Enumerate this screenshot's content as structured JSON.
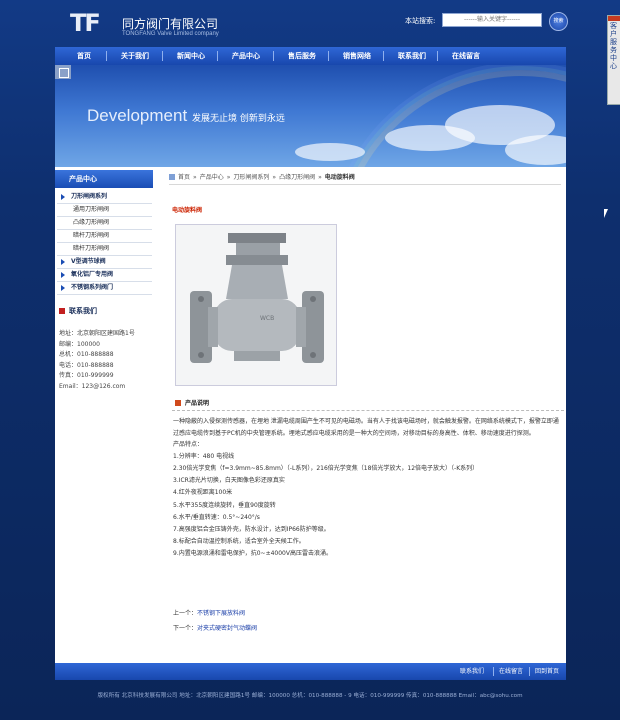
{
  "header": {
    "logo_mark": "TF",
    "company_cn": "同方阀门有限公司",
    "company_en": "TONGFANG Valve Limited company",
    "search_label": "本站搜索:",
    "search_placeholder": "------输入关键字------",
    "search_button": "搜索"
  },
  "side_tab": {
    "label": "客户服务中心"
  },
  "nav": {
    "items": [
      "首页",
      "关于我们",
      "新闻中心",
      "产品中心",
      "售后服务",
      "销售网络",
      "联系我们",
      "在线留言"
    ]
  },
  "banner": {
    "english": "Development",
    "slogan": "发展无止境 创新到永远"
  },
  "sidebar": {
    "title": "产品中心",
    "categories": [
      {
        "label": "刀形闸阀系列",
        "type": "main"
      },
      {
        "label": "通用刀形闸阀",
        "type": "sub"
      },
      {
        "label": "凸缘刀形闸阀",
        "type": "sub"
      },
      {
        "label": "暗杆刀形闸阀",
        "type": "sub"
      },
      {
        "label": "暗杆刀形闸阀",
        "type": "sub"
      },
      {
        "label": "V型调节球阀",
        "type": "main"
      },
      {
        "label": "氧化铝厂专用阀",
        "type": "main"
      },
      {
        "label": "不锈钢系列阀门",
        "type": "main"
      }
    ],
    "contact_title": "联系我们",
    "contact_lines": [
      "地址：北京朝阳区建国路1号",
      "邮编：100000",
      "总机：010-888888",
      "电话：010-888888",
      "传真：010-999999",
      "Email：123@126.com"
    ]
  },
  "breadcrumb": {
    "items": [
      "首页",
      "产品中心",
      "刀形闸阀系列",
      "凸缘刀形闸阀"
    ],
    "separator": "»",
    "current": "电动旋料阀"
  },
  "product": {
    "title": "电动旋料阀",
    "desc_title": "产品说明",
    "paragraph": "一种隐蔽的入侵探测传感器，在埋地 泄漏电缆周围产生不可见的电磁场。当有人于找该电磁场时，就会触发报警。在网络系统模式下，报警立即通过感应电缆传到基于PC机的中央管理系统。埋地式感应电缆采用的是一种大的空间场，对移动目标的身高性、体积、移动速度进行探测。",
    "features_title": "产品特点：",
    "features": [
      "1.分辨率：480 电视线",
      "2.30倍光学变焦（f=3.9mm~85.8mm）（-L系列），216倍光学变焦（18倍光学放大，12倍电子放大）（-K系列）",
      "3.ICR滤光片切换，白天图像色彩还原真实",
      "4.红外夜视距离100米",
      "5.水平355度连续旋转，垂直90度旋转",
      "6.水平/垂直转速：0.5°~240°/s",
      "7.高强度铝合金压铸外壳，防水设计，达到IP66防护等级。",
      "8.标配合自动温控制系统，适合室外全天候工作。",
      "9.内置电源浪涌和雷电保护，抗0~±4000V高压雷击浪涌。"
    ],
    "prev_label": "上一个：",
    "prev_link": "不锈钢下展放料阀",
    "next_label": "下一个：",
    "next_link": "对夹式硬密封气动蝶阀"
  },
  "footer": {
    "links": [
      "联系我们",
      "在线留言",
      "回到首页"
    ],
    "copyright": "版权所有  北京科技发展有限公司 地址：北京朝阳区建国路1号 邮编：100000  总机：010-888888 - 9 电话：010-999999 传真：010-888888 Email：abc@sohu.com"
  },
  "colors": {
    "nav_blue": "#1847ad",
    "accent_red": "#cc2200",
    "page_bg": "#0d2a63"
  }
}
